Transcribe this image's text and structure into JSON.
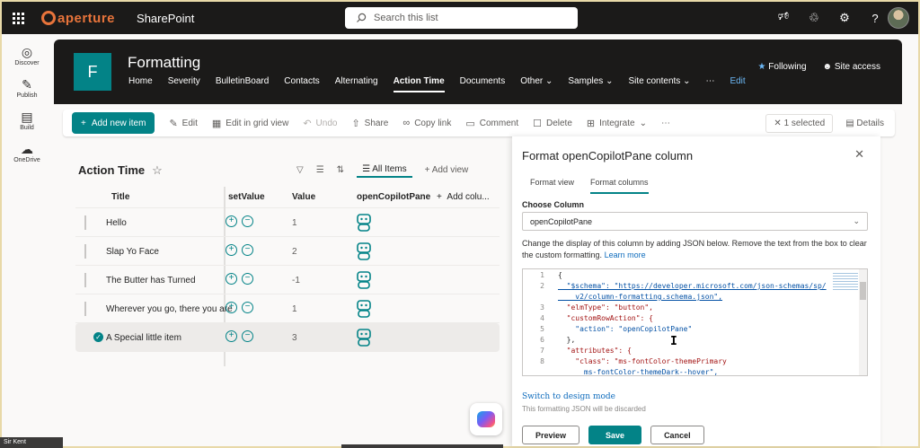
{
  "suitebar": {
    "brand": "aperture",
    "app_name": "SharePoint",
    "search_placeholder": "Search this list",
    "icons": [
      "megaphone-icon",
      "share-icon",
      "gear-icon",
      "help-icon"
    ]
  },
  "appbar": {
    "items": [
      {
        "label": "Discover",
        "icon": "compass-icon"
      },
      {
        "label": "Publish",
        "icon": "pen-icon"
      },
      {
        "label": "Build",
        "icon": "build-icon"
      },
      {
        "label": "OneDrive",
        "icon": "cloud-icon"
      }
    ]
  },
  "site": {
    "logo_letter": "F",
    "title": "Formatting",
    "nav": [
      "Home",
      "Severity",
      "BulletinBoard",
      "Contacts",
      "Alternating",
      "Action Time",
      "Documents",
      "Other",
      "Samples",
      "Site contents",
      "⋯",
      "Edit"
    ],
    "active_nav": "Action Time",
    "following": "Following",
    "site_access": "Site access"
  },
  "commandbar": {
    "new_item": "Add new item",
    "edit": "Edit",
    "grid": "Edit in grid view",
    "undo": "Undo",
    "share": "Share",
    "copy_link": "Copy link",
    "comment": "Comment",
    "delete": "Delete",
    "integrate": "Integrate",
    "more": "⋯",
    "selected": "1 selected",
    "details": "Details"
  },
  "list": {
    "view_title": "Action Time",
    "view_name": "All Items",
    "add_view": "Add view",
    "columns": {
      "title": "Title",
      "setvalue": "setValue",
      "value": "Value",
      "ocp": "openCopilotPane",
      "add": "Add colu..."
    },
    "rows": [
      {
        "title": "Hello",
        "value": "1",
        "selected": false
      },
      {
        "title": "Slap Yo Face",
        "value": "2",
        "selected": false
      },
      {
        "title": "The Butter has Turned",
        "value": "-1",
        "selected": false
      },
      {
        "title": "Wherever you go, there you are",
        "value": "1",
        "selected": false
      },
      {
        "title": "A Special little item",
        "value": "3",
        "selected": true
      }
    ]
  },
  "panel": {
    "title": "Format openCopilotPane column",
    "tab_view": "Format view",
    "tab_columns": "Format columns",
    "choose_label": "Choose Column",
    "selected_column": "openCopilotPane",
    "description": "Change the display of this column by adding JSON below. Remove the text from the box to clear the custom formatting.",
    "learn_more": "Learn more",
    "switch_link": "Switch to design mode",
    "discard_note": "This formatting JSON will be discarded",
    "preview": "Preview",
    "save": "Save",
    "cancel": "Cancel",
    "code_lines": [
      {
        "n": "1",
        "text": "{"
      },
      {
        "n": "2",
        "text": "  \"$schema\": \"https://developer.microsoft.com/json-schemas/sp/"
      },
      {
        "n": "",
        "text": "    v2/column-formatting.schema.json\","
      },
      {
        "n": "3",
        "text": "  \"elmType\": \"button\","
      },
      {
        "n": "4",
        "text": "  \"customRowAction\": {"
      },
      {
        "n": "5",
        "text": "    \"action\": \"openCopilotPane\""
      },
      {
        "n": "6",
        "text": "  },"
      },
      {
        "n": "7",
        "text": "  \"attributes\": {"
      },
      {
        "n": "8",
        "text": "    \"class\": \"ms-fontColor-themePrimary"
      },
      {
        "n": "",
        "text": "      ms-fontColor-themeDark--hover\","
      }
    ]
  },
  "footer": {
    "user": "Sir Kent"
  },
  "colors": {
    "accent": "#038387",
    "brand": "#e8743b",
    "header_bg": "#1b1a19",
    "link": "#0f6cbd"
  }
}
